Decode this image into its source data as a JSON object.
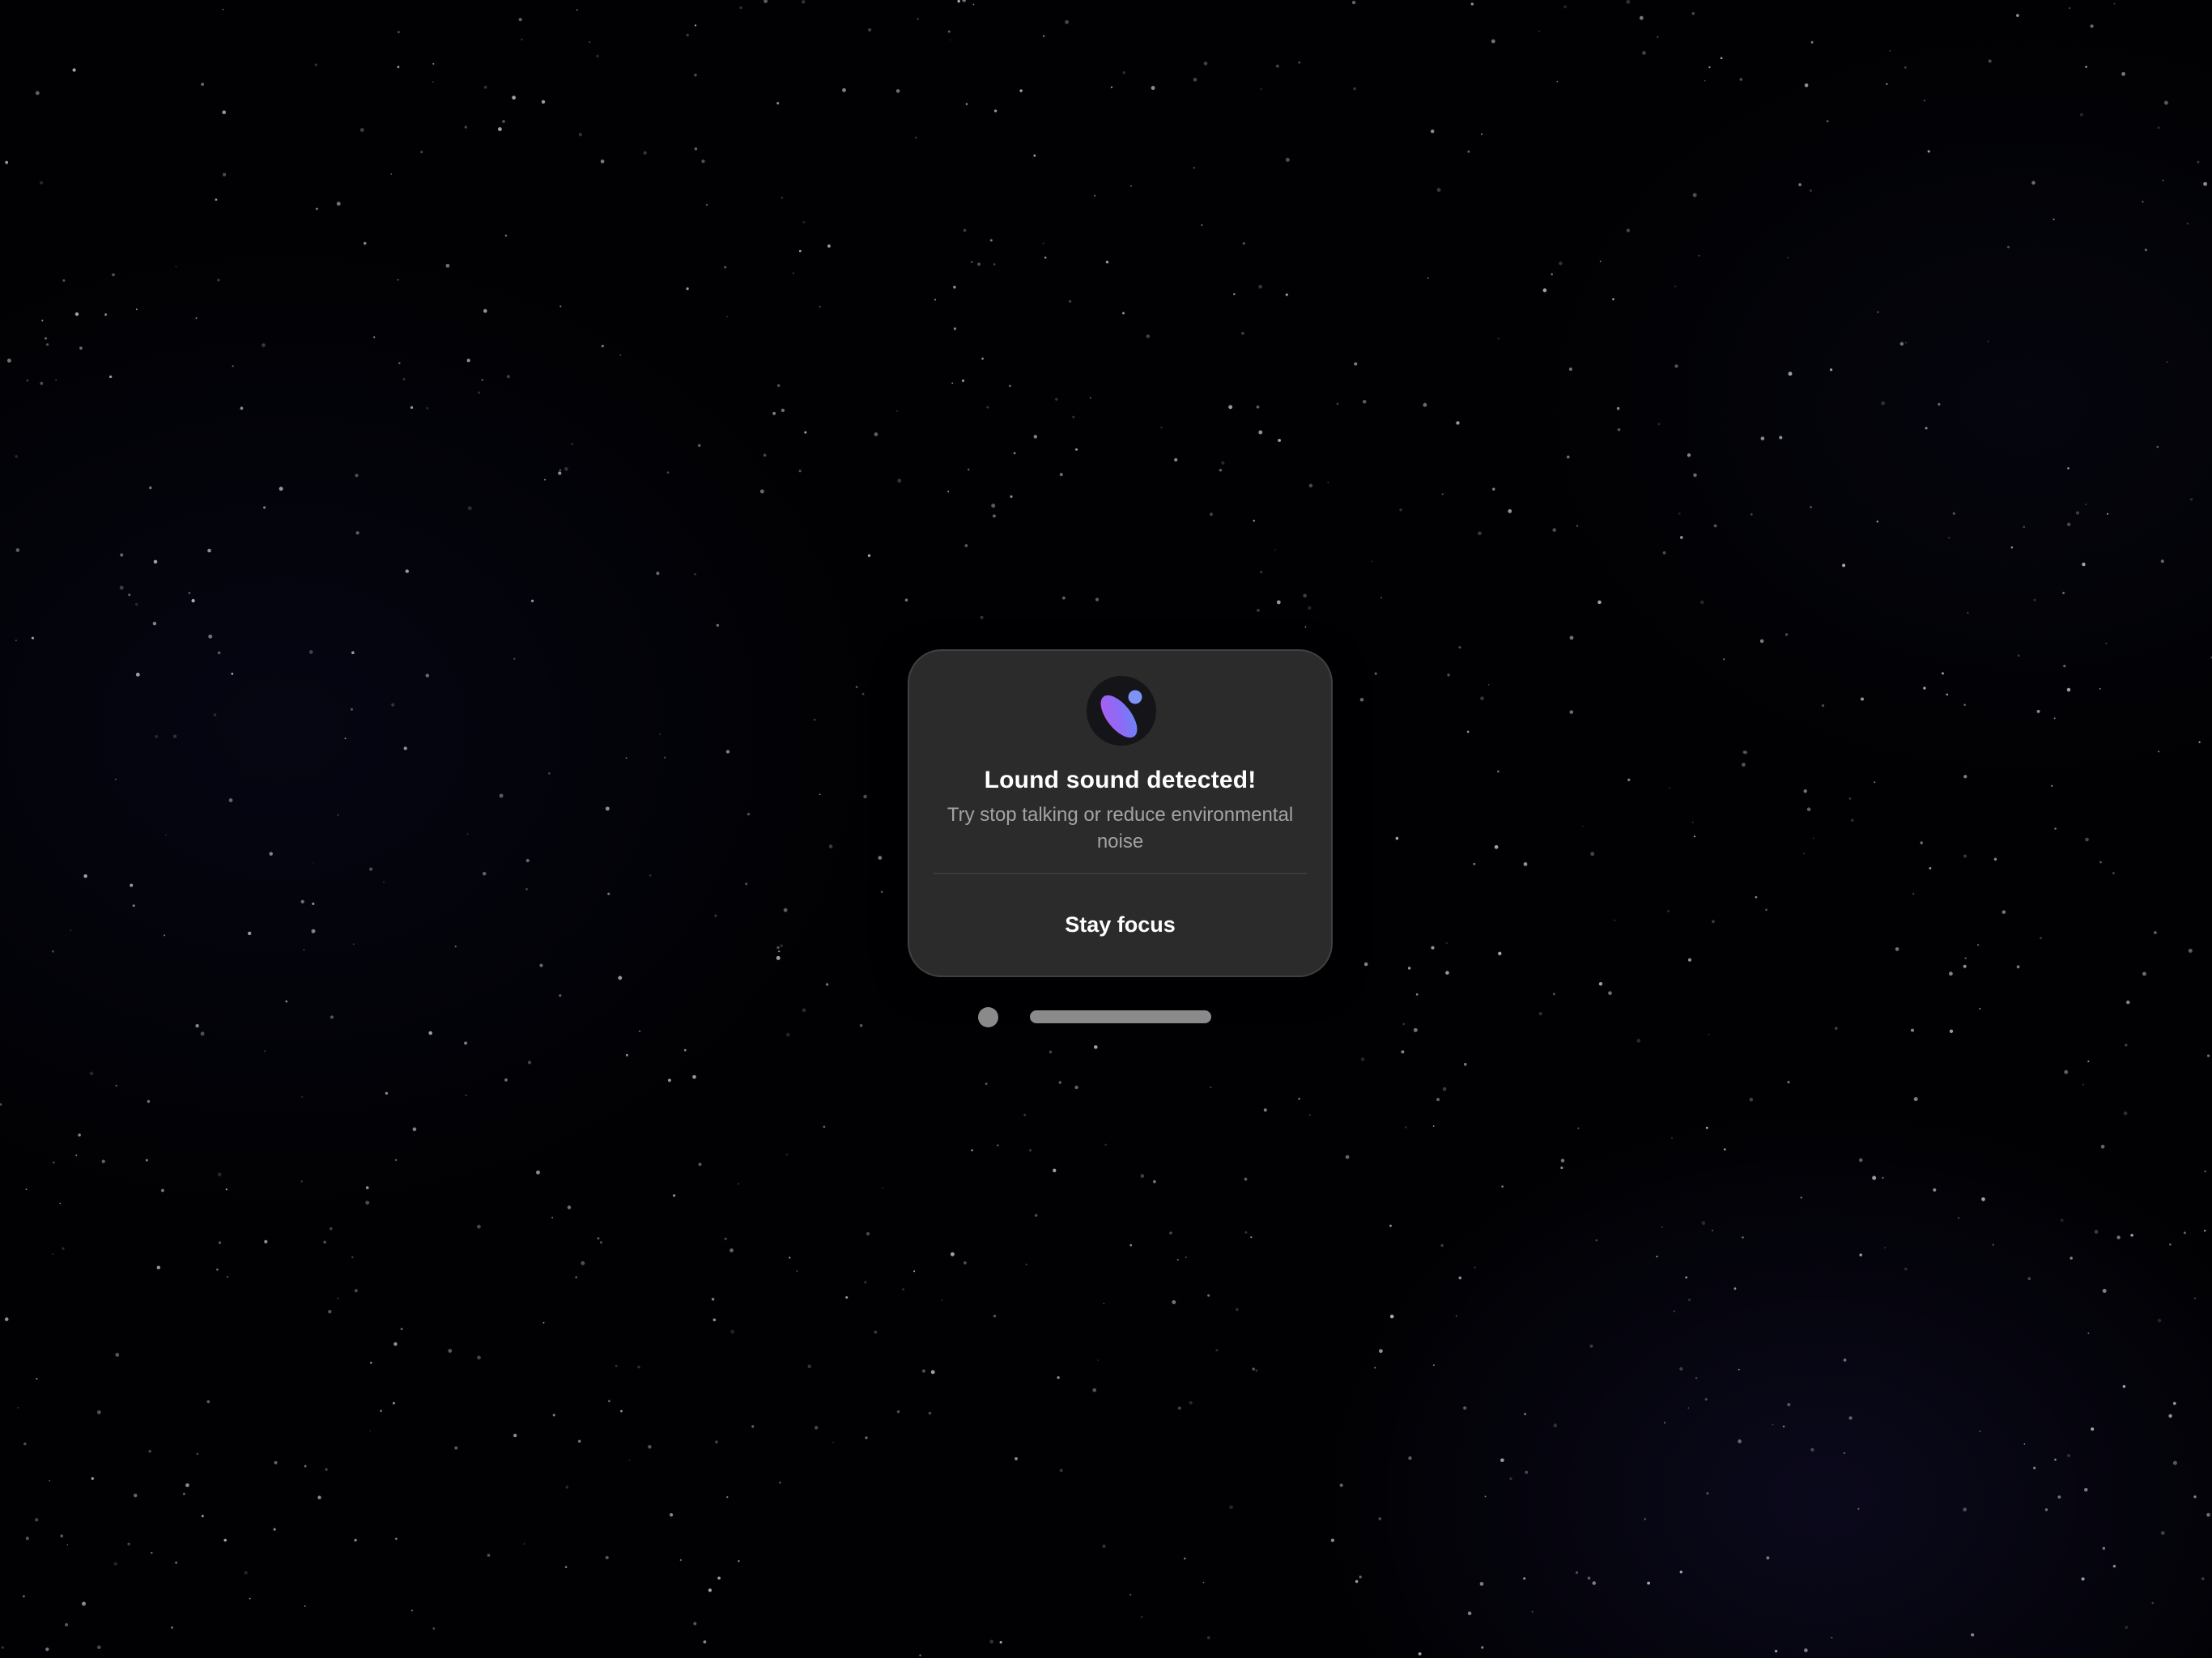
{
  "alert": {
    "icon": "app-logo-icon",
    "title": "Lound sound detected!",
    "message": "Try stop talking or reduce environmental noise",
    "action_label": "Stay focus"
  },
  "window_controls": {
    "dot_icon": "window-close-dot",
    "bar_icon": "window-grabber-bar"
  },
  "colors": {
    "background": "#010103",
    "card": "#2b2b2b",
    "accent_violet": "#8a5cf6",
    "accent_blue": "#6f8df5",
    "secondary_text": "#a3a3a3"
  }
}
